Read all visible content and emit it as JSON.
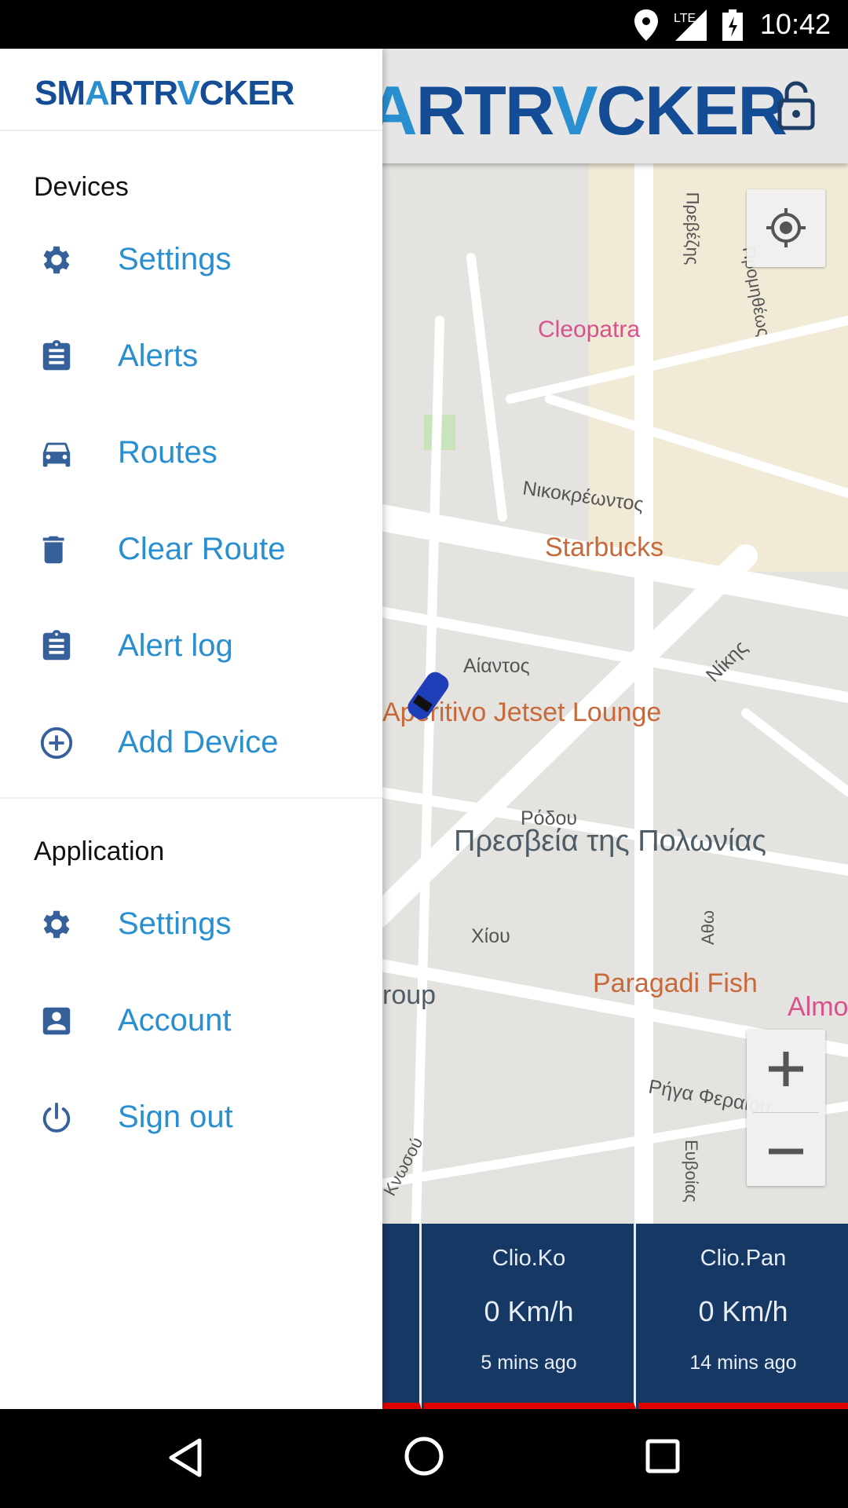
{
  "status_bar": {
    "time": "10:42",
    "network": "LTE",
    "icons": [
      "location-icon",
      "signal-icon",
      "battery-charging-icon"
    ]
  },
  "app_bar": {
    "logo": "SMARTRACKER",
    "logo_parts": [
      "SM",
      "A",
      "RTR",
      "V",
      "CKER"
    ],
    "lock_icon": "lock-open-icon"
  },
  "drawer": {
    "logo": "SMARTRACKER",
    "sections": [
      {
        "title": "Devices",
        "items": [
          {
            "label": "Settings",
            "icon": "gear-icon"
          },
          {
            "label": "Alerts",
            "icon": "clipboard-icon"
          },
          {
            "label": "Routes",
            "icon": "car-icon"
          },
          {
            "label": "Clear Route",
            "icon": "trash-icon"
          },
          {
            "label": "Alert log",
            "icon": "clipboard-icon"
          },
          {
            "label": "Add Device",
            "icon": "add-circle-icon"
          }
        ]
      },
      {
        "title": "Application",
        "items": [
          {
            "label": "Settings",
            "icon": "gear-icon"
          },
          {
            "label": "Account",
            "icon": "account-box-icon"
          },
          {
            "label": "Sign out",
            "icon": "power-icon"
          }
        ]
      }
    ]
  },
  "map": {
    "labels": [
      "Cleopatra",
      "Νικοκρέωντος",
      "Starbucks",
      "Αίαντος",
      "Νίκης",
      "Aperitivo Jetset Lounge",
      "Ρόδου",
      "Πρεσβεία της Πολωνίας",
      "Χίου",
      "Paragadi Fish",
      "Almo",
      "roup",
      "Ρήγα Φεραίου",
      "Ευβοίας",
      "Αθω",
      "Κνωσού",
      "Πρεβέζης",
      "Προμηθέως"
    ]
  },
  "devices": [
    {
      "name": "Clio.Ko",
      "speed": "0 Km/h",
      "updated": "5 mins ago"
    },
    {
      "name": "Clio.Pan",
      "speed": "0 Km/h",
      "updated": "14 mins ago"
    }
  ],
  "colors": {
    "brand_dark": "#144d96",
    "brand_light": "#2a8fd0",
    "icon": "#35609a",
    "card_bg": "#163865",
    "card_accent": "#e00000"
  }
}
